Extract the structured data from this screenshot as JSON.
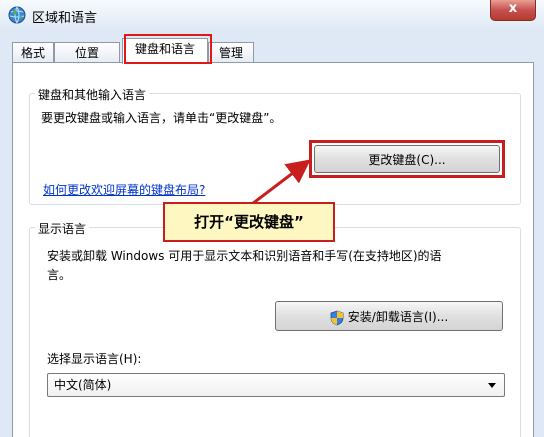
{
  "window": {
    "title": "区域和语言",
    "close_label": "x"
  },
  "tabs": [
    {
      "label": "格式",
      "active": false
    },
    {
      "label": "位置",
      "active": false
    },
    {
      "label": "键盘和语言",
      "active": true
    },
    {
      "label": "管理",
      "active": false
    }
  ],
  "keyboard_group": {
    "title": "键盘和其他输入语言",
    "description": "要更改键盘或输入语言，请单击“更改键盘”。",
    "change_keyboard_button": "更改键盘(C)...",
    "help_link": "如何更改欢迎屏幕的键盘布局?"
  },
  "callout": {
    "text": "打开“更改键盘”"
  },
  "display_group": {
    "title": "显示语言",
    "description_line1": "安装或卸载 Windows 可用于显示文本和识别语音和手写(在支持地区)的语",
    "description_line2": "言。",
    "install_button": "安装/卸载语言(I)...",
    "select_label": "选择显示语言(H):",
    "select_value": "中文(简体)"
  },
  "colors": {
    "highlight": "#c81e1e",
    "link": "#0033cc",
    "callout_bg": "#fff7c2"
  }
}
